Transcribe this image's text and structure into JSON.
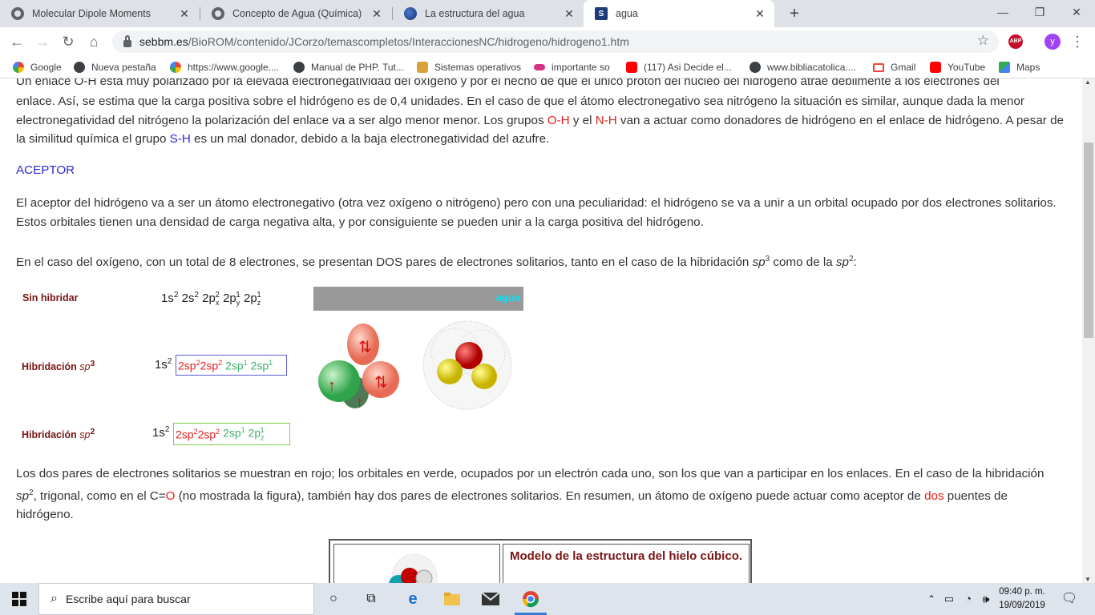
{
  "browser": {
    "tabs": [
      {
        "title": "Molecular Dipole Moments",
        "icon": "globe-icon",
        "active": false
      },
      {
        "title": "Concepto de Agua (Química)",
        "icon": "globe-icon",
        "active": false
      },
      {
        "title": "La estructura del agua",
        "icon": "earth-icon",
        "active": false
      },
      {
        "title": "agua",
        "icon": "site-logo-icon",
        "active": true
      }
    ],
    "url_domain": "sebbm.es",
    "url_path": "/BioROM/contenido/JCorzo/temascompletos/InteraccionesNC/hidrogeno/hidrogeno1.htm",
    "abp_label": "ABP",
    "avatar_letter": "y",
    "bookmarks": [
      "Google",
      "Nueva pestaña",
      "https://www.google....",
      "Manual de PHP. Tut...",
      "Sistemas operativos",
      "importante so",
      "(117) Asi Decide el...",
      "www.bibliacatolica....",
      "Gmail",
      "YouTube",
      "Maps"
    ]
  },
  "page": {
    "para1_line0": "Un enlace O-H está muy polarizado por la elevada electronegatividad del oxígeno y por el hecho de que el único protón del núcleo del hidrógeno atrae débilmente a los electrones del",
    "para1_a": "enlace. Así, se estima que la carga positiva sobre el hidrógeno es de 0,4 unidades. En el caso de que el átomo electronegativo sea nitrógeno la situación es similar, aunque dada la menor electronegatividad del nitrógeno la polarización del enlace va a ser algo menor menor. Los grupos ",
    "para1_oh": "O-H",
    "para1_b": " y el ",
    "para1_nh": "N-H",
    "para1_c": " van a actuar como donadores de hidrógeno en el enlace de hidrógeno. A pesar de la similitud química el grupo ",
    "para1_sh": "S-H",
    "para1_d": " es un mal donador, debido a la baja electronegatividad del azufre.",
    "heading_aceptor": "ACEPTOR",
    "para2": "El aceptor del hidrógeno va a ser un átomo electronegativo (otra vez oxígeno o nitrógeno) pero con una peculiaridad: el hidrógeno se va a unir a un orbital ocupado por dos electrones solitarios. Estos orbitales tienen una densidad de carga negativa alta, y por consiguiente se pueden unir a la carga positiva del hidrógeno.",
    "para3_a": "En el caso del oxígeno, con un total de 8 electrones, se presentan DOS pares de electrones solitarios, tanto en el caso de la hibridación ",
    "para3_sp3": "sp",
    "para3_sup3": "3",
    "para3_b": " como de la ",
    "para3_sp2": "sp",
    "para3_sup2": "2",
    "para3_c": ":",
    "fig": {
      "label_sin": "Sin hibridar",
      "label_hib": "Hibridación ",
      "sp": "sp",
      "sup3": "3",
      "sup2": "2",
      "banner_text": "agua"
    },
    "para4_a": "Los dos pares de electrones solitarios se muestran en rojo; los orbitales en verde, ocupados por un electrón cada uno, son los que van a  participar en los enlaces. En el caso de la hibridación ",
    "para4_sp": "sp",
    "para4_sup": "2",
    "para4_b": ", trigonal, como en el C=",
    "para4_o": "O",
    "para4_c": " (no mostrada la figura), también hay dos pares de electrones solitarios. En resumen, un átomo de oxígeno puede actuar como aceptor de ",
    "para4_dos": "dos",
    "para4_d": " puentes de hidrógeno.",
    "table_title": "Modelo de la estructura del hielo cúbico."
  },
  "taskbar": {
    "search_placeholder": "Escribe aquí para buscar",
    "time": "09:40 p. m.",
    "date": "19/09/2019"
  }
}
